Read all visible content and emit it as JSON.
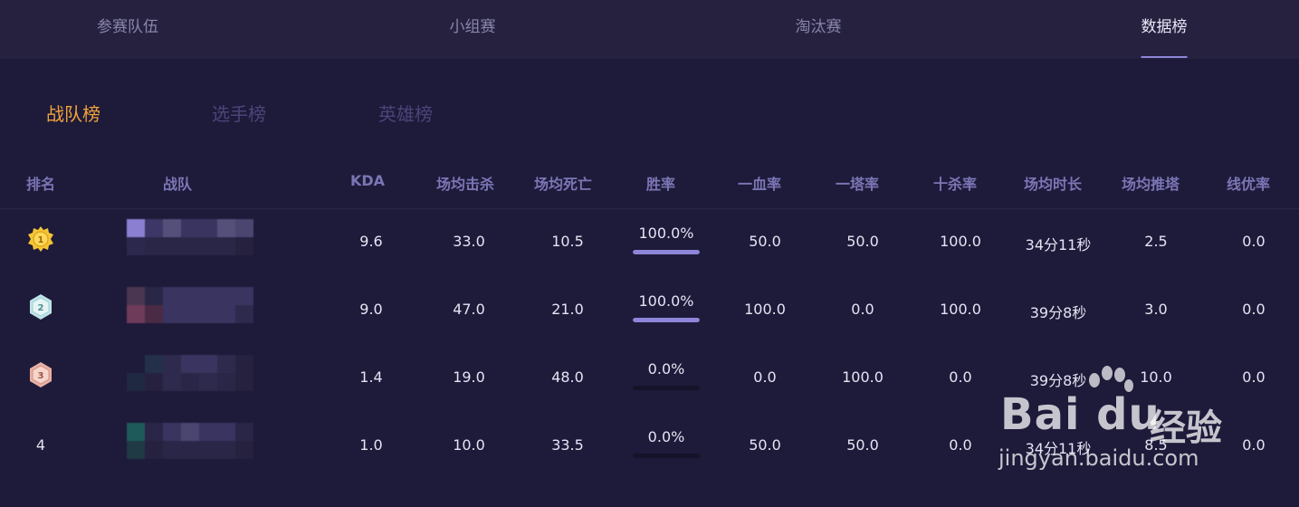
{
  "nav": {
    "tabs": [
      {
        "label": "参赛队伍"
      },
      {
        "label": "小组赛"
      },
      {
        "label": "淘汰赛"
      },
      {
        "label": "数据榜"
      }
    ],
    "active": "数据榜"
  },
  "subtabs": {
    "items": [
      {
        "label": "战队榜"
      },
      {
        "label": "选手榜"
      },
      {
        "label": "英雄榜"
      }
    ],
    "active": "战队榜"
  },
  "table": {
    "headers": [
      "排名",
      "战队",
      "KDA",
      "场均击杀",
      "场均死亡",
      "胜率",
      "一血率",
      "一塔率",
      "十杀率",
      "场均时长",
      "场均推塔",
      "线优率"
    ],
    "rows": [
      {
        "rank": "1",
        "badge": "gold-medal-icon",
        "kda": "9.6",
        "kills": "33.0",
        "deaths": "10.5",
        "win_rate": "100.0%",
        "win_fraction": 1.0,
        "first_blood": "50.0",
        "first_tower": "50.0",
        "ten_kill": "100.0",
        "duration": "34分11秒",
        "towers": "2.5",
        "lane": "0.0"
      },
      {
        "rank": "2",
        "badge": "silver-medal-icon",
        "kda": "9.0",
        "kills": "47.0",
        "deaths": "21.0",
        "win_rate": "100.0%",
        "win_fraction": 1.0,
        "first_blood": "100.0",
        "first_tower": "0.0",
        "ten_kill": "100.0",
        "duration": "39分8秒",
        "towers": "3.0",
        "lane": "0.0"
      },
      {
        "rank": "3",
        "badge": "bronze-medal-icon",
        "kda": "1.4",
        "kills": "19.0",
        "deaths": "48.0",
        "win_rate": "0.0%",
        "win_fraction": 0.0,
        "first_blood": "0.0",
        "first_tower": "100.0",
        "ten_kill": "0.0",
        "duration": "39分8秒",
        "towers": "10.0",
        "lane": "0.0"
      },
      {
        "rank": "4",
        "badge": "",
        "kda": "1.0",
        "kills": "10.0",
        "deaths": "33.5",
        "win_rate": "0.0%",
        "win_fraction": 0.0,
        "first_blood": "50.0",
        "first_tower": "50.0",
        "ten_kill": "0.0",
        "duration": "34分11秒",
        "towers": "8.5",
        "lane": "0.0"
      }
    ]
  },
  "watermark": {
    "brand": "Bai du",
    "brand_cn": "经验",
    "url": "jingyan.baidu.com"
  },
  "colors": {
    "accent": "#8d85d8",
    "active_subtab": "#f0a23a",
    "background": "#1e1a3a",
    "header_text": "#7b76b4"
  }
}
